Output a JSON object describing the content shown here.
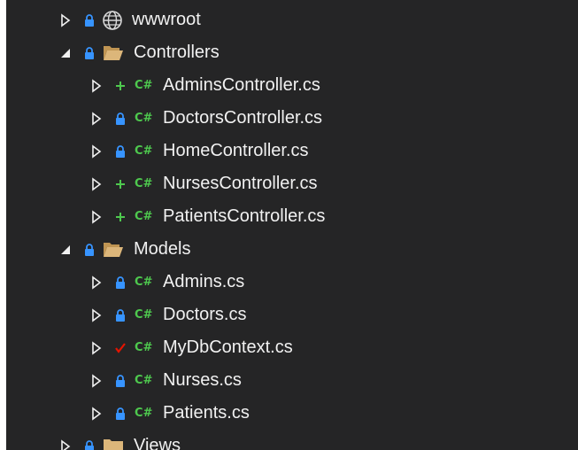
{
  "solution_explorer": {
    "nodes": [
      {
        "label": "wwwroot",
        "icon": "globe-icon",
        "status": "lock",
        "expanded": false
      },
      {
        "label": "Controllers",
        "icon": "folder-icon",
        "status": "lock",
        "expanded": true
      },
      {
        "label": "AdminsController.cs",
        "icon": "csharp-file-icon",
        "status": "added",
        "expanded": false
      },
      {
        "label": "DoctorsController.cs",
        "icon": "csharp-file-icon",
        "status": "lock",
        "expanded": false
      },
      {
        "label": "HomeController.cs",
        "icon": "csharp-file-icon",
        "status": "lock",
        "expanded": false
      },
      {
        "label": "NursesController.cs",
        "icon": "csharp-file-icon",
        "status": "added",
        "expanded": false
      },
      {
        "label": "PatientsController.cs",
        "icon": "csharp-file-icon",
        "status": "added",
        "expanded": false
      },
      {
        "label": "Models",
        "icon": "folder-icon",
        "status": "lock",
        "expanded": true
      },
      {
        "label": "Admins.cs",
        "icon": "csharp-file-icon",
        "status": "lock",
        "expanded": false
      },
      {
        "label": "Doctors.cs",
        "icon": "csharp-file-icon",
        "status": "lock",
        "expanded": false
      },
      {
        "label": "MyDbContext.cs",
        "icon": "csharp-file-icon",
        "status": "modified",
        "expanded": false
      },
      {
        "label": "Nurses.cs",
        "icon": "csharp-file-icon",
        "status": "lock",
        "expanded": false
      },
      {
        "label": "Patients.cs",
        "icon": "csharp-file-icon",
        "status": "lock",
        "expanded": false
      },
      {
        "label": "Views",
        "icon": "folder-icon",
        "status": "lock",
        "expanded": false
      }
    ],
    "csharp_glyph": "C#",
    "colors": {
      "background": "#252526",
      "text": "#f1f1f1",
      "lock": "#3794ff",
      "added": "#4ec94e",
      "modified": "#e51400",
      "folder": "#dcb67a",
      "csharp": "#4ec94e"
    }
  }
}
